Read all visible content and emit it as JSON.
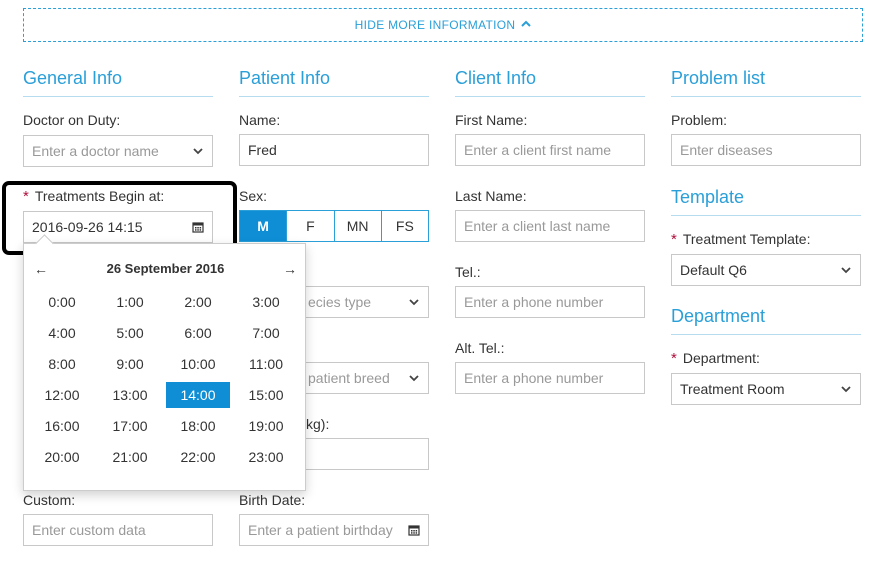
{
  "topbar": {
    "label": "HIDE MORE INFORMATION",
    "icon": "chevron-up-icon"
  },
  "general": {
    "title": "General Info",
    "doctor_label": "Doctor on Duty:",
    "doctor_placeholder": "Enter a doctor name",
    "treat_label": "Treatments Begin at:",
    "treat_value": "2016-09-26 14:15",
    "custom_label": "Custom:",
    "custom_placeholder": "Enter custom data"
  },
  "patient": {
    "title": "Patient Info",
    "name_label": "Name:",
    "name_value": "Fred",
    "sex_label": "Sex:",
    "sex_options": [
      "M",
      "F",
      "MN",
      "FS"
    ],
    "sex_selected": "M",
    "species_placeholder_partial": "ecies type",
    "breed_placeholder_partial": "patient breed",
    "weight_label_partial": "kg):",
    "birth_label": "Birth Date:",
    "birth_placeholder": "Enter a patient birthday"
  },
  "client": {
    "title": "Client Info",
    "first_label": "First Name:",
    "first_placeholder": "Enter a client first name",
    "last_label": "Last Name:",
    "last_placeholder": "Enter a client last name",
    "tel_label": "Tel.:",
    "tel_placeholder": "Enter a phone number",
    "alt_label": "Alt. Tel.:",
    "alt_placeholder": "Enter a phone number"
  },
  "problem": {
    "title": "Problem list",
    "problem_label": "Problem:",
    "problem_placeholder": "Enter diseases"
  },
  "template": {
    "title": "Template",
    "label": "Treatment Template:",
    "value": "Default Q6"
  },
  "department": {
    "title": "Department",
    "label": "Department:",
    "value": "Treatment Room"
  },
  "picker": {
    "date_title": "26 September 2016",
    "prev": "←",
    "next": "→",
    "hours": [
      "0:00",
      "1:00",
      "2:00",
      "3:00",
      "4:00",
      "5:00",
      "6:00",
      "7:00",
      "8:00",
      "9:00",
      "10:00",
      "11:00",
      "12:00",
      "13:00",
      "14:00",
      "15:00",
      "16:00",
      "17:00",
      "18:00",
      "19:00",
      "20:00",
      "21:00",
      "22:00",
      "23:00"
    ],
    "selected": "14:00"
  },
  "colors": {
    "accent": "#2a9fd8",
    "selected": "#0f8ed6",
    "required": "#b0103a"
  }
}
